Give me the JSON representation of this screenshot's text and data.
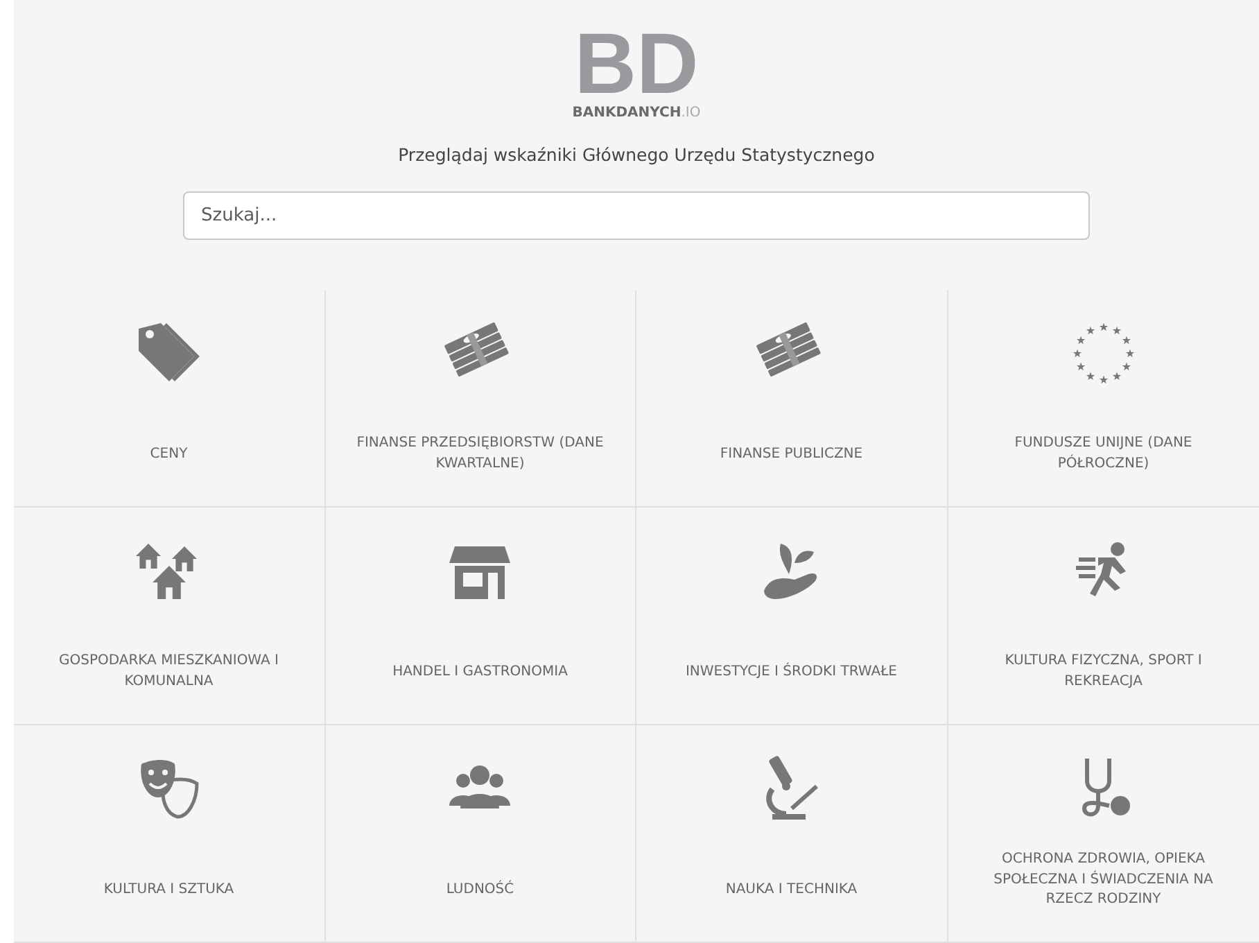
{
  "logo": {
    "mark": "BD",
    "name": "BANKDANYCH",
    "suffix": ".IO"
  },
  "tagline": "Przeglądaj wskaźniki Głównego Urzędu Statystycznego",
  "search": {
    "placeholder": "Szukaj..."
  },
  "categories": [
    {
      "kind": "tag",
      "label": "CENY"
    },
    {
      "kind": "money",
      "label": "FINANSE PRZEDSIĘBIORSTW (DANE KWARTALNE)"
    },
    {
      "kind": "money",
      "label": "FINANSE PUBLICZNE"
    },
    {
      "kind": "stars",
      "label": "FUNDUSZE UNIJNE (DANE PÓŁROCZNE)"
    },
    {
      "kind": "houses",
      "label": "GOSPODARKA MIESZKANIOWA I KOMUNALNA"
    },
    {
      "kind": "shop",
      "label": "HANDEL I GASTRONOMIA"
    },
    {
      "kind": "plant",
      "label": "INWESTYCJE I ŚRODKI TRWAŁE"
    },
    {
      "kind": "runner",
      "label": "KULTURA FIZYCZNA, SPORT I REKREACJA"
    },
    {
      "kind": "masks",
      "label": "KULTURA I SZTUKA"
    },
    {
      "kind": "people",
      "label": "LUDNOŚĆ"
    },
    {
      "kind": "microscope",
      "label": "NAUKA I TECHNIKA"
    },
    {
      "kind": "stethoscope",
      "label": "OCHRONA ZDROWIA, OPIEKA SPOŁECZNA I ŚWIADCZENIA NA RZECZ RODZINY"
    }
  ]
}
